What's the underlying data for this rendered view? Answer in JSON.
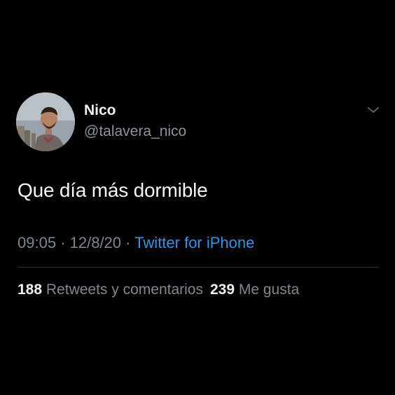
{
  "user": {
    "display_name": "Nico",
    "handle": "@talavera_nico",
    "avatar_icon": "profile-photo"
  },
  "tweet": {
    "text": "Que día más dormible"
  },
  "meta": {
    "time": "09:05",
    "separator": " · ",
    "date": "12/8/20",
    "source": "Twitter for iPhone"
  },
  "stats": {
    "retweets_count": "188",
    "retweets_label": "Retweets y comentarios",
    "likes_count": "239",
    "likes_label": "Me gusta"
  },
  "colors": {
    "background": "#000000",
    "accent": "#1d9bf0",
    "secondary_text": "#7f878e"
  }
}
